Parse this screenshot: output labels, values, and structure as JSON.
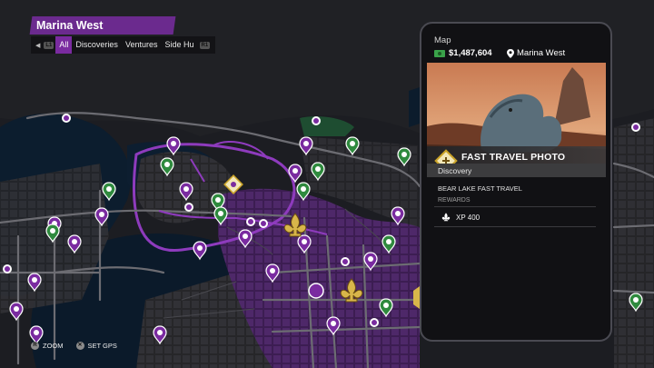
{
  "region": {
    "name": "Marina West"
  },
  "filters": {
    "left_button": "L1",
    "right_button": "R1",
    "tabs": [
      "All",
      "Discoveries",
      "Ventures",
      "Side Hu"
    ],
    "active": "All"
  },
  "panel": {
    "title": "Map",
    "money": "$1,487,604",
    "location": "Marina West",
    "item_name": "FAST TRAVEL PHOTO",
    "category": "Discovery",
    "description": "BEAR LAKE FAST TRAVEL",
    "rewards_label": "REWARDS",
    "reward_value": "XP 400"
  },
  "controls": {
    "zoom_label": "ZOOM",
    "gps_label": "SET GPS"
  },
  "colors": {
    "territory_purple": "#6b2a8e",
    "accent_gold": "#c9a227",
    "water": "#0a1b2c",
    "green_marker": "#3a9a4a"
  },
  "icons": [
    "fleur-de-lis-icon",
    "fast-travel-icon",
    "discovery-icon",
    "collectible-icon",
    "location-pin-icon",
    "cash-icon"
  ]
}
